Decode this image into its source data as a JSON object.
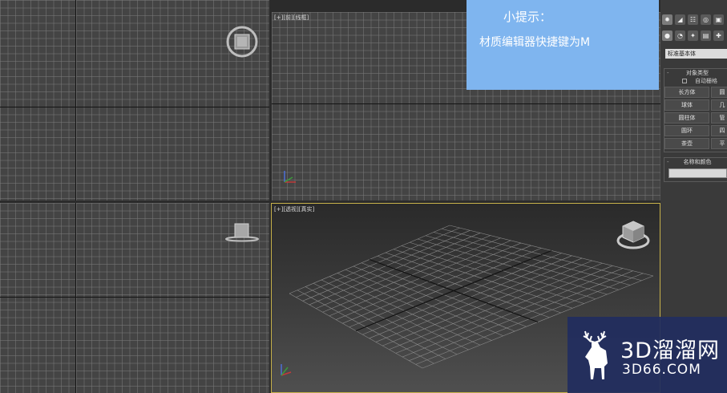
{
  "tip": {
    "title": "小提示：",
    "body": "材质编辑器快捷键为M",
    "color": "#7fb5ef"
  },
  "viewports": {
    "top_right_label": "[+][前][线框]",
    "perspective_label": "[+][透视][真实]",
    "active_border_color": "#c7b14a"
  },
  "panel": {
    "tabs_row1": [
      "sun-icon",
      "curve-icon",
      "hierarchy-icon",
      "hammer-icon",
      "display-icon",
      "utilities-icon"
    ],
    "tabs_row2": [
      "sphere-icon",
      "shapes-icon",
      "light-icon",
      "camera-icon",
      "helper-icon",
      "spacewarp-icon",
      "systems-icon"
    ],
    "subtype": "标准基本体",
    "object_type": {
      "header": "对象类型",
      "autogrid": "自动栅格",
      "buttons": [
        "长方体",
        "圆",
        "球体",
        "几",
        "圆柱体",
        "管",
        "圆环",
        "四",
        "茶壶",
        "平"
      ]
    },
    "name_color": {
      "header": "名称和颜色"
    }
  },
  "watermark": {
    "brand": "3D溜溜网",
    "url": "3D66.COM"
  }
}
